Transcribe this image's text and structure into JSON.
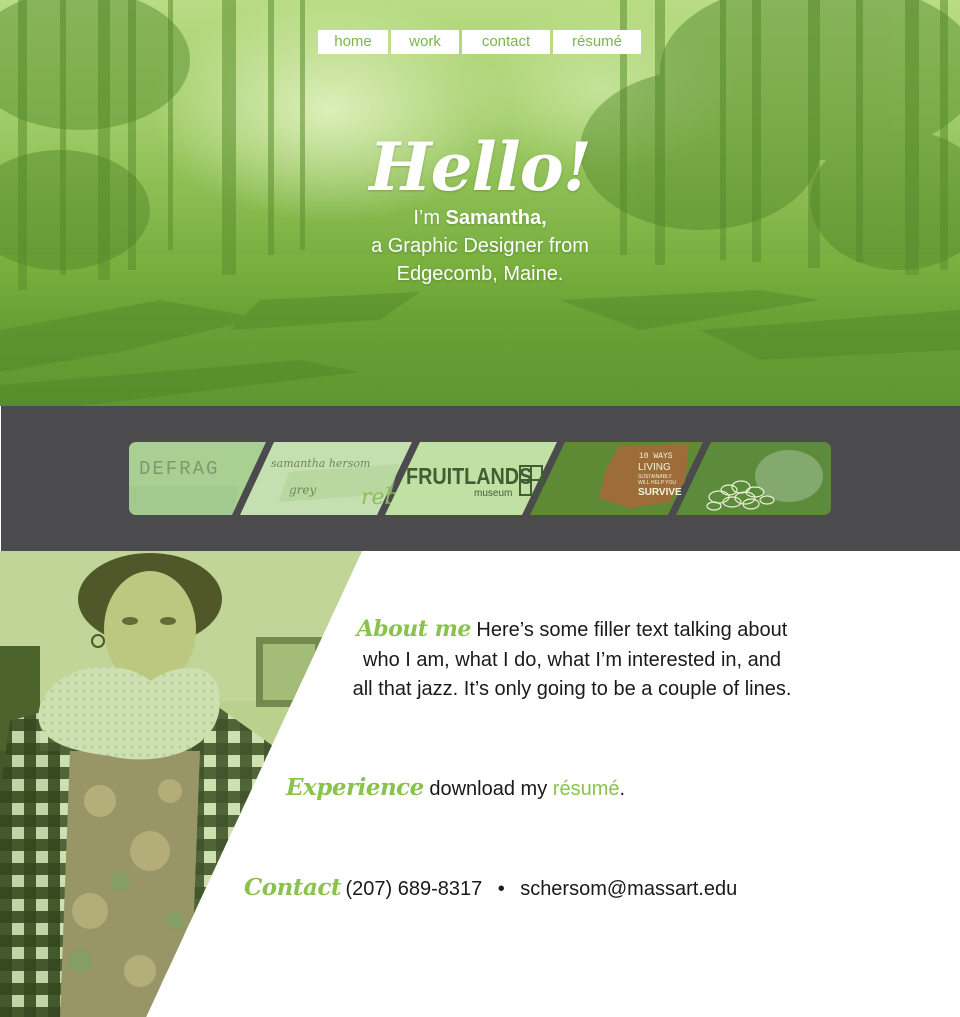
{
  "nav": {
    "home": "home",
    "work": "work",
    "contact": "contact",
    "resume": "résumé"
  },
  "hero": {
    "greeting": "Hello!",
    "intro_prefix": "I’m ",
    "name": "Samantha,",
    "line2": "a Graphic Designer from",
    "line3": "Edgecomb, Maine."
  },
  "portfolio": {
    "items": [
      {
        "label": "DEFRAG",
        "icon": "defrag-thumbnail"
      },
      {
        "label": "samantha hersom",
        "icon": "typography-thumbnail"
      },
      {
        "label": "FRUITLANDS",
        "sublabel": "museum",
        "icon": "fruitlands-thumbnail"
      },
      {
        "label": "10 WAYS LIVING SUSTAINABLY WILL HELP YOU SURVIVE",
        "icon": "sustainability-poster-thumbnail"
      },
      {
        "label": "",
        "icon": "rubber-bands-photo-thumbnail"
      }
    ]
  },
  "about": {
    "about_heading": "About me",
    "about_text_1": " Here’s some filler text talking about",
    "about_text_2": "who I am, what I do, what I’m interested in, and",
    "about_text_3": "all that jazz. It’s only going to be a couple of lines.",
    "experience_heading": "Experience",
    "experience_text": " download my ",
    "experience_link": "résumé",
    "experience_end": ".",
    "contact_heading": "Contact",
    "phone": "(207) 689-8317",
    "separator": "•",
    "email": "schersom@massart.edu"
  },
  "colors": {
    "accent": "#8ac34b",
    "strip_bg": "#4b4b4d",
    "nav_bg": "#ffffff"
  }
}
